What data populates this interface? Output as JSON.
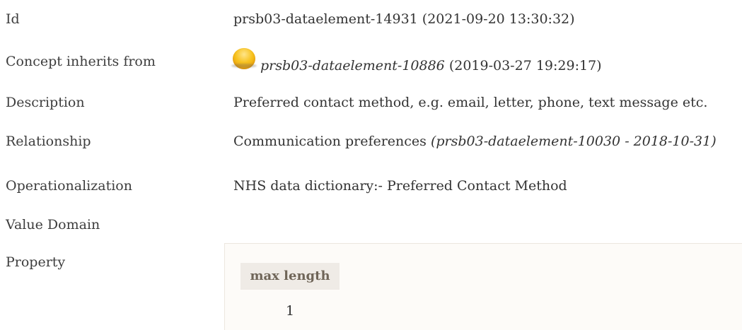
{
  "fields": {
    "id": {
      "label": "Id",
      "value": "prsb03-dataelement-14931 (2021-09-20 13:30:32)"
    },
    "inherits": {
      "label": "Concept inherits from",
      "ref": "prsb03-dataelement-10886",
      "date": " (2019-03-27 19:29:17)",
      "icon": "inherit-circle-icon",
      "icon_color": "#f5b51a"
    },
    "description": {
      "label": "Description",
      "value": "Preferred contact method, e.g. email, letter, phone, text message etc."
    },
    "relationship": {
      "label": "Relationship",
      "value": "Communication preferences ",
      "ref": "(prsb03-dataelement-10030 - 2018-10-31)"
    },
    "operationalization": {
      "label": "Operationalization",
      "value": "NHS data dictionary:- Preferred Contact Method"
    },
    "value_domain": {
      "label": "Value Domain"
    },
    "property": {
      "label": "Property",
      "columns": [
        "max length"
      ],
      "values": [
        "1"
      ]
    }
  }
}
